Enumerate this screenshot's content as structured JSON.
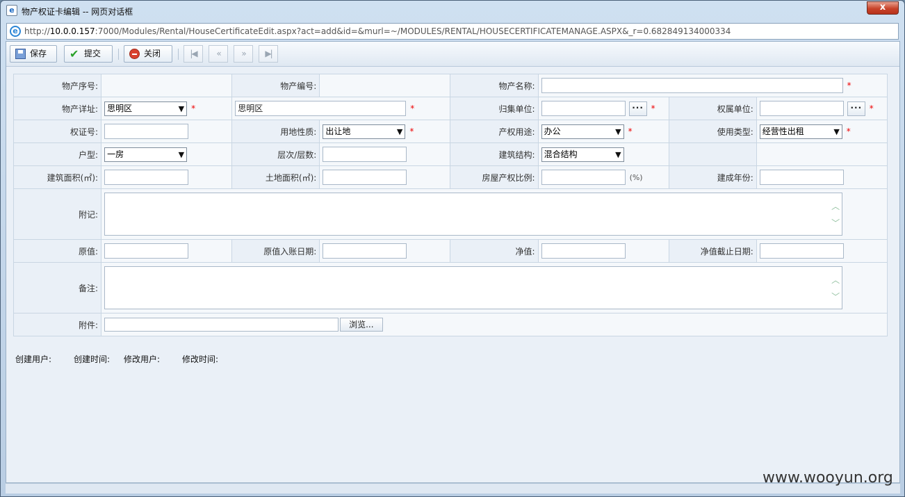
{
  "window": {
    "title": "物产权证卡编辑 -- 网页对话框",
    "close_label": "x",
    "url_prefix": "http://",
    "url_host": "10.0.0.157",
    "url_rest": ":7000/Modules/Rental/HouseCertificateEdit.aspx?act=add&id=&murl=~/MODULES/RENTAL/HOUSECERTIFICATEMANAGE.ASPX&_r=0.682849134000334"
  },
  "toolbar": {
    "save_label": "保存",
    "submit_label": "提交",
    "close_label": "关闭",
    "first_label": "|◀",
    "prev_label": "«",
    "next_label": "»",
    "last_label": "▶|"
  },
  "form": {
    "row1": {
      "serial_label": "物产序号:",
      "code_label": "物产编号:",
      "name_label": "物产名称:"
    },
    "row2": {
      "address_label": "物产详址:",
      "district": "思明区",
      "address_value": "思明区",
      "collect_label": "归集单位:",
      "owner_label": "权属单位:"
    },
    "row3": {
      "cert_label": "权证号:",
      "land_label": "用地性质:",
      "land_value": "出让地",
      "usage_label": "产权用途:",
      "usage_value": "办公",
      "type_label": "使用类型:",
      "type_value": "经营性出租"
    },
    "row4": {
      "house_label": "户型:",
      "house_value": "一房",
      "floor_label": "层次/层数:",
      "struct_label": "建筑结构:",
      "struct_value": "混合结构"
    },
    "row5": {
      "build_area_label": "建筑面积(㎡):",
      "land_area_label": "土地面积(㎡):",
      "ratio_label": "房屋产权比例:",
      "ratio_unit": "(%)",
      "year_label": "建成年份:"
    },
    "row6": {
      "note_label": "附记:"
    },
    "row7": {
      "orig_label": "原值:",
      "orig_date_label": "原值入账日期:",
      "net_label": "净值:",
      "net_date_label": "净值截止日期:"
    },
    "row8": {
      "remark_label": "备注:"
    },
    "row9": {
      "attach_label": "附件:",
      "browse_label": "浏览..."
    },
    "required_mark": "*"
  },
  "meta": {
    "created_user_label": "创建用户:",
    "created_time_label": "创建时间:",
    "modified_user_label": "修改用户:",
    "modified_time_label": "修改时间:"
  },
  "watermark": "www.wooyun.org"
}
